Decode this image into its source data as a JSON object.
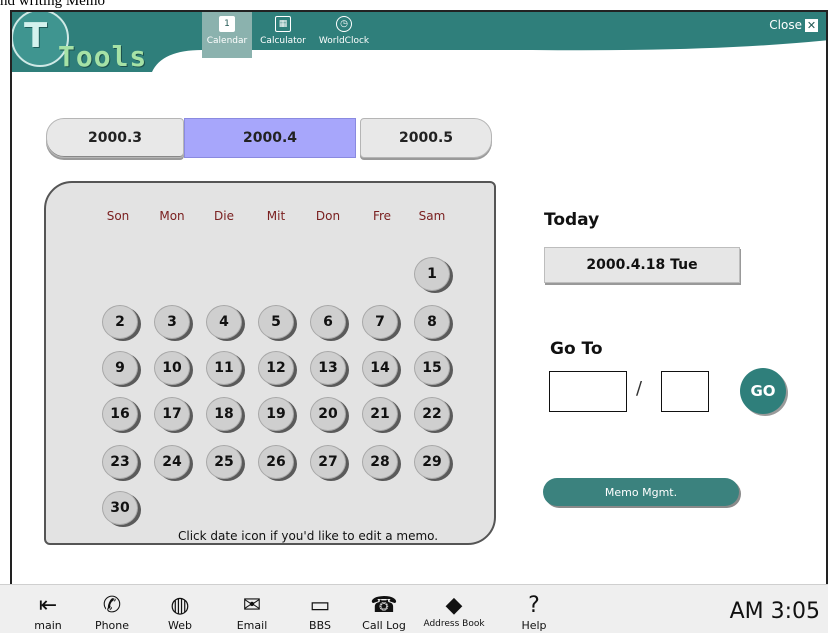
{
  "caption": "nd writing Memo",
  "app": {
    "logo_t": "T",
    "logo_text": "Tools",
    "tabs": [
      {
        "label": "Calendar",
        "icon": "calendar-icon",
        "glyph": "1"
      },
      {
        "label": "Calculator",
        "icon": "calculator-icon",
        "glyph": "▦"
      },
      {
        "label": "WorldClock",
        "icon": "clock-icon",
        "glyph": "◷"
      }
    ],
    "close_label": "Close",
    "close_glyph": "✕",
    "accent_color": "#2f7f7b"
  },
  "months": {
    "prev": "2000.3",
    "current": "2000.4",
    "next": "2000.5"
  },
  "calendar": {
    "weekdays": [
      "Son",
      "Mon",
      "Die",
      "Mit",
      "Don",
      "Fre",
      "Sam"
    ],
    "days": [
      "1",
      "2",
      "3",
      "4",
      "5",
      "6",
      "7",
      "8",
      "9",
      "10",
      "11",
      "12",
      "13",
      "14",
      "15",
      "16",
      "17",
      "18",
      "19",
      "20",
      "21",
      "22",
      "23",
      "24",
      "25",
      "26",
      "27",
      "28",
      "29",
      "30"
    ],
    "hint": "Click date icon if you'd like to edit a memo."
  },
  "today": {
    "label": "Today",
    "value": "2000.4.18 Tue"
  },
  "goto": {
    "label": "Go To",
    "separator": "/",
    "button": "GO"
  },
  "memo_button": "Memo Mgmt.",
  "taskbar": {
    "items": [
      {
        "label": "main",
        "icon": "exit-arrow-icon",
        "glyph": "⇤"
      },
      {
        "label": "Phone",
        "icon": "phone-icon",
        "glyph": "✆"
      },
      {
        "label": "Web",
        "icon": "globe-icon",
        "glyph": "◍"
      },
      {
        "label": "Email",
        "icon": "envelope-icon",
        "glyph": "✉"
      },
      {
        "label": "BBS",
        "icon": "computer-icon",
        "glyph": "▭"
      },
      {
        "label": "Call Log",
        "icon": "call-log-icon",
        "glyph": "☎"
      },
      {
        "label": "Address Book",
        "icon": "address-book-icon",
        "glyph": "◆"
      },
      {
        "label": "Help",
        "icon": "help-icon",
        "glyph": "?"
      }
    ],
    "clock": "AM 3:05"
  }
}
